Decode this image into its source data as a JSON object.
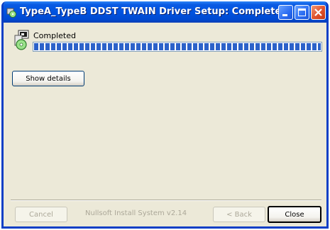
{
  "window": {
    "title": "TypeA_TypeB DDST TWAIN Driver Setup: Completed",
    "title_color": "#0054e3"
  },
  "status": {
    "label": "Completed",
    "progress_fraction": 1.0,
    "bar_color": "#2c62c9"
  },
  "buttons": {
    "show_details": "Show details",
    "cancel": "Cancel",
    "back": "< Back",
    "close": "Close"
  },
  "footer": {
    "branding": "Nullsoft Install System v2.14"
  },
  "icons": {
    "app": "installer-icon",
    "status": "installer-cd-icon"
  }
}
